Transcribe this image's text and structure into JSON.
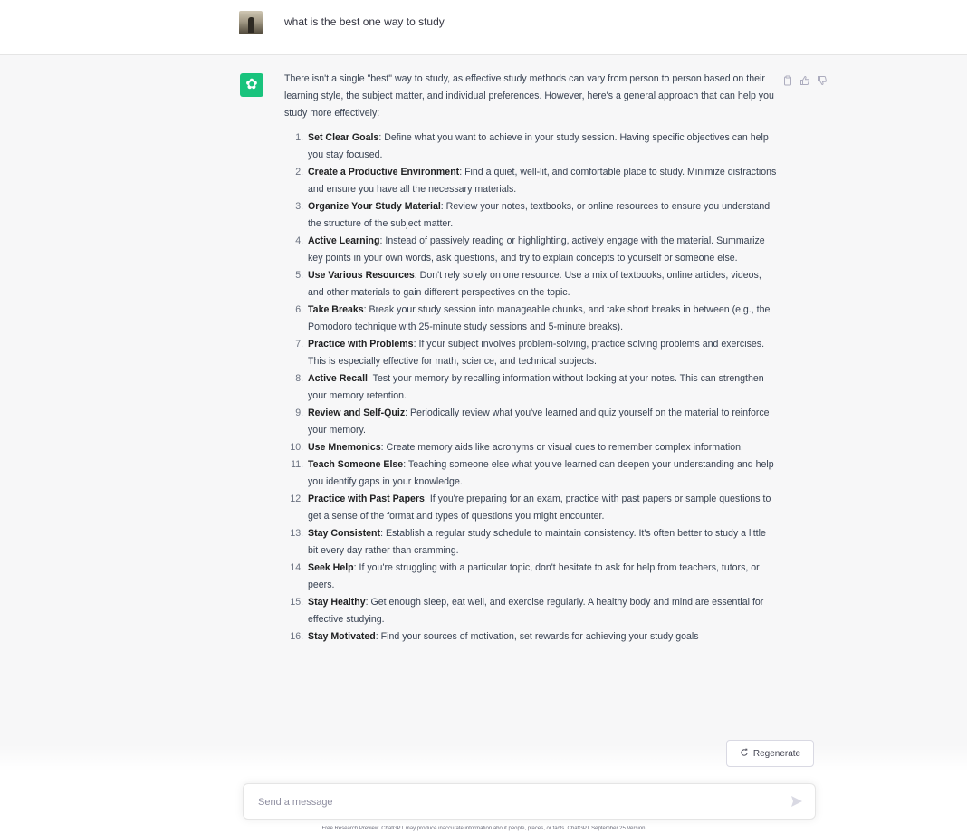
{
  "user_message": "what is the best one way to study",
  "assistant": {
    "avatar_glyph": "✿",
    "intro": "There isn't a single \"best\" way to study, as effective study methods can vary from person to person based on their learning style, the subject matter, and individual preferences. However, here's a general approach that can help you study more effectively:",
    "steps": [
      {
        "title": "Set Clear Goals",
        "text": ": Define what you want to achieve in your study session. Having specific objectives can help you stay focused."
      },
      {
        "title": "Create a Productive Environment",
        "text": ": Find a quiet, well-lit, and comfortable place to study. Minimize distractions and ensure you have all the necessary materials."
      },
      {
        "title": "Organize Your Study Material",
        "text": ": Review your notes, textbooks, or online resources to ensure you understand the structure of the subject matter."
      },
      {
        "title": "Active Learning",
        "text": ": Instead of passively reading or highlighting, actively engage with the material. Summarize key points in your own words, ask questions, and try to explain concepts to yourself or someone else."
      },
      {
        "title": "Use Various Resources",
        "text": ": Don't rely solely on one resource. Use a mix of textbooks, online articles, videos, and other materials to gain different perspectives on the topic."
      },
      {
        "title": "Take Breaks",
        "text": ": Break your study session into manageable chunks, and take short breaks in between (e.g., the Pomodoro technique with 25-minute study sessions and 5-minute breaks)."
      },
      {
        "title": "Practice with Problems",
        "text": ": If your subject involves problem-solving, practice solving problems and exercises. This is especially effective for math, science, and technical subjects."
      },
      {
        "title": "Active Recall",
        "text": ": Test your memory by recalling information without looking at your notes. This can strengthen your memory retention."
      },
      {
        "title": "Review and Self-Quiz",
        "text": ": Periodically review what you've learned and quiz yourself on the material to reinforce your memory."
      },
      {
        "title": "Use Mnemonics",
        "text": ": Create memory aids like acronyms or visual cues to remember complex information."
      },
      {
        "title": "Teach Someone Else",
        "text": ": Teaching someone else what you've learned can deepen your understanding and help you identify gaps in your knowledge."
      },
      {
        "title": "Practice with Past Papers",
        "text": ": If you're preparing for an exam, practice with past papers or sample questions to get a sense of the format and types of questions you might encounter."
      },
      {
        "title": "Stay Consistent",
        "text": ": Establish a regular study schedule to maintain consistency. It's often better to study a little bit every day rather than cramming."
      },
      {
        "title": "Seek Help",
        "text": ": If you're struggling with a particular topic, don't hesitate to ask for help from teachers, tutors, or peers."
      },
      {
        "title": "Stay Healthy",
        "text": ": Get enough sleep, eat well, and exercise regularly. A healthy body and mind are essential for effective studying."
      },
      {
        "title": "Stay Motivated",
        "text": ": Find your sources of motivation, set rewards for achieving your study goals"
      }
    ]
  },
  "actions": {
    "copy_icon": "clipboard-icon",
    "like_icon": "thumbs-up-icon",
    "dislike_icon": "thumbs-down-icon"
  },
  "regenerate_label": "Regenerate",
  "input": {
    "placeholder": "Send a message",
    "value": ""
  },
  "footer": "Free Research Preview. ChatGPT may produce inaccurate information about people, places, or facts. ChatGPT September 25 Version",
  "colors": {
    "accent": "#19c37d",
    "response_bg": "#f7f7f8",
    "text": "#374151"
  }
}
